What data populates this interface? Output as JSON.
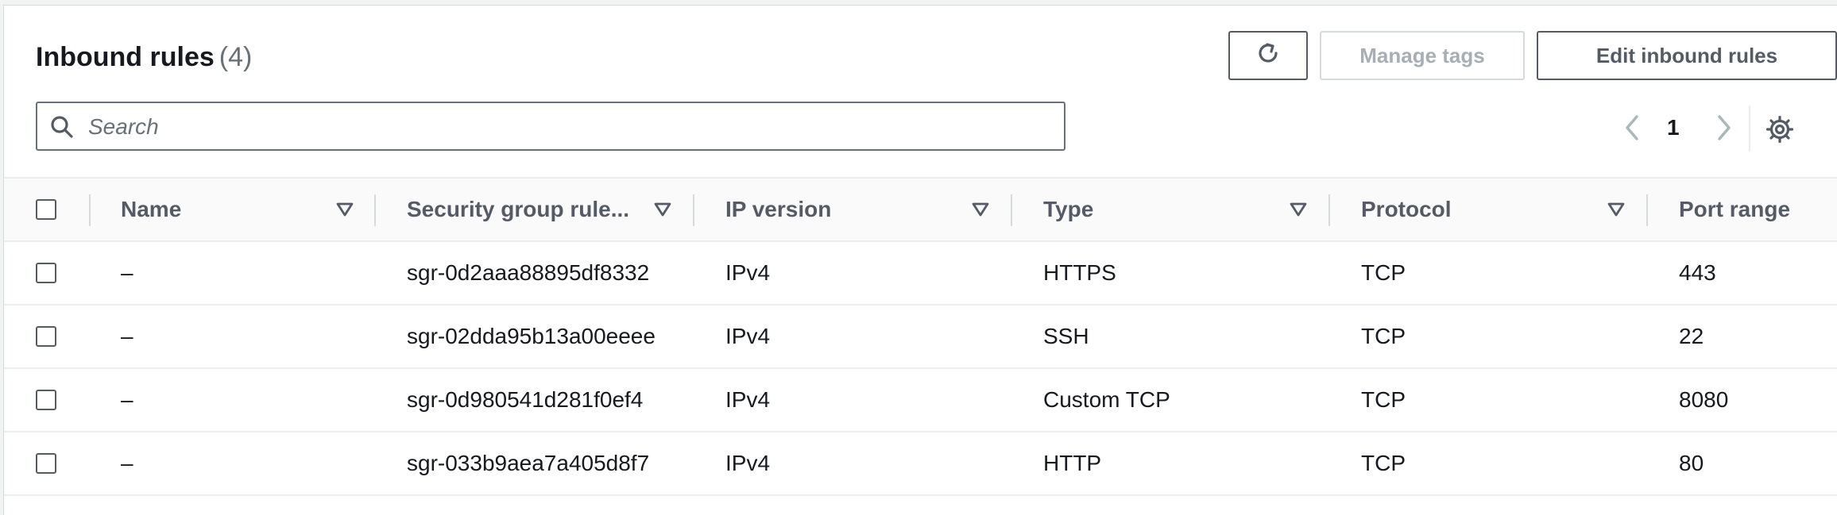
{
  "header": {
    "title": "Inbound rules",
    "count": "(4)",
    "manage_tags_label": "Manage tags",
    "edit_rules_label": "Edit inbound rules"
  },
  "search": {
    "placeholder": "Search",
    "value": ""
  },
  "pagination": {
    "current_page": "1"
  },
  "table": {
    "columns": [
      "Name",
      "Security group rule...",
      "IP version",
      "Type",
      "Protocol",
      "Port range"
    ],
    "rows": [
      {
        "name": "–",
        "rule_id": "sgr-0d2aaa88895df8332",
        "ip_version": "IPv4",
        "type": "HTTPS",
        "protocol": "TCP",
        "port_range": "443"
      },
      {
        "name": "–",
        "rule_id": "sgr-02dda95b13a00eeee",
        "ip_version": "IPv4",
        "type": "SSH",
        "protocol": "TCP",
        "port_range": "22"
      },
      {
        "name": "–",
        "rule_id": "sgr-0d980541d281f0ef4",
        "ip_version": "IPv4",
        "type": "Custom TCP",
        "protocol": "TCP",
        "port_range": "8080"
      },
      {
        "name": "–",
        "rule_id": "sgr-033b9aea7a405d8f7",
        "ip_version": "IPv4",
        "type": "HTTP",
        "protocol": "TCP",
        "port_range": "80"
      }
    ]
  },
  "icons": {
    "refresh": "refresh-icon",
    "search": "search-icon",
    "prev": "chevron-left-icon",
    "next": "chevron-right-icon",
    "settings": "gear-icon",
    "sort": "sort-caret-icon"
  },
  "colors": {
    "text_primary": "#16191f",
    "text_secondary": "#545b64",
    "border": "#eaeded",
    "disabled": "#a7afb5"
  }
}
